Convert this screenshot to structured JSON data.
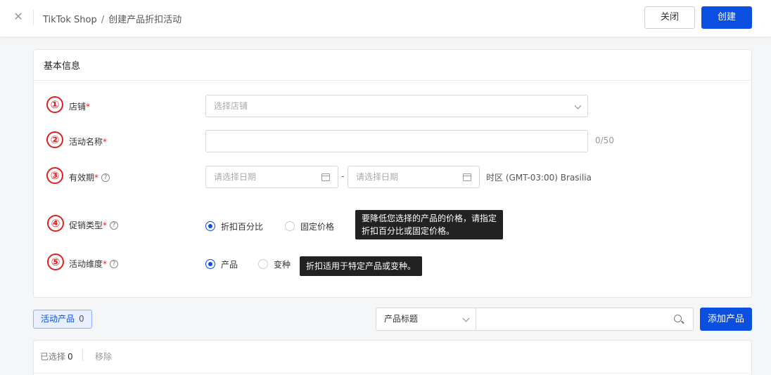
{
  "header": {
    "breadcrumb": [
      "TikTok Shop",
      "创建产品折扣活动"
    ],
    "separator": "/",
    "close_label": "关闭",
    "create_label": "创建"
  },
  "basic_info": {
    "title": "基本信息",
    "shop": {
      "number": "①",
      "label": "店铺",
      "placeholder": "选择店铺"
    },
    "name": {
      "number": "②",
      "label": "活动名称",
      "value": "",
      "counter": "0/50"
    },
    "period": {
      "number": "③",
      "label": "有效期",
      "start_placeholder": "请选择日期",
      "end_placeholder": "请选择日期",
      "dash": "-",
      "timezone": "时区 (GMT-03:00) Brasilia"
    },
    "promo_type": {
      "number": "④",
      "label": "促销类型",
      "options": [
        "折扣百分比",
        "固定价格"
      ],
      "selected": "折扣百分比",
      "tooltip": [
        "要降低您选择的产品的价格，请指定",
        "折扣百分比或固定价格。"
      ]
    },
    "dimension": {
      "number": "⑤",
      "label": "活动维度",
      "options": [
        "产品",
        "变种"
      ],
      "selected": "产品",
      "tooltip": "折扣适用于特定产品或变种。"
    },
    "required_mark": "*",
    "help_mark": "?"
  },
  "products": {
    "tab_label": "活动产品",
    "tab_count": "0",
    "filter_select": "产品标题",
    "search_value": "",
    "add_label": "添加产品",
    "selected_label": "已选择",
    "selected_count": "0",
    "remove_label": "移除"
  },
  "colors": {
    "primary": "#0a4fe0",
    "required": "#e02020"
  }
}
